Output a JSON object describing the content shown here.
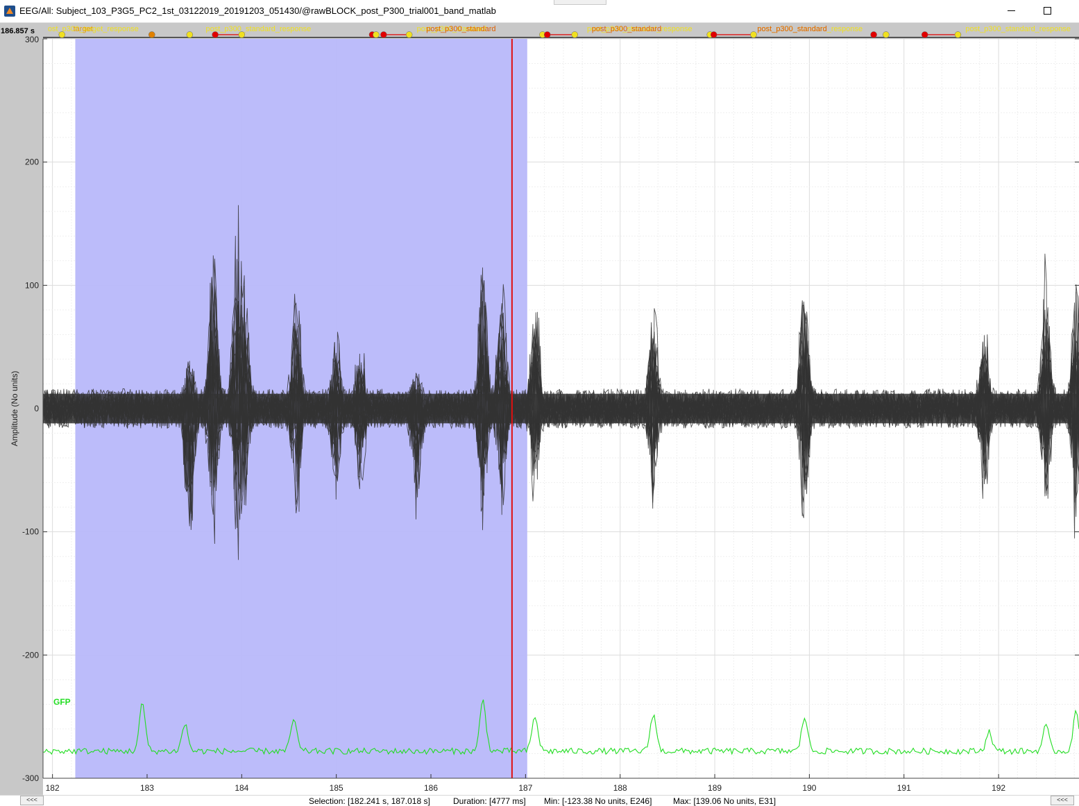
{
  "window": {
    "title": "EEG/All: Subject_103_P3G5_PC2_1st_03122019_20191203_051430/@rawBLOCK_post_P300_trial001_band_matlab",
    "icon": "matlab-icon",
    "minimize_icon": "minimize-icon",
    "maximize_icon": "maximize-icon"
  },
  "time_readout": "186.857 s",
  "chart_data": {
    "type": "line",
    "ylabel": "Amplitude (No units)",
    "xlim": [
      181.9,
      192.85
    ],
    "ylim": [
      -300,
      300
    ],
    "x_ticks": [
      182,
      183,
      184,
      185,
      186,
      187,
      188,
      189,
      190,
      191,
      192
    ],
    "y_ticks": [
      -300,
      -200,
      -100,
      0,
      100,
      200,
      300
    ],
    "grid": true,
    "selection": {
      "start": 182.241,
      "end": 187.018,
      "color": "#b8b8fa"
    },
    "cursor_time": 186.857,
    "cursor_color": "#e01010",
    "trace_color": "#333333",
    "gfp_color": "#22dd22",
    "series": [
      {
        "name": "GFP",
        "color": "#22dd22"
      }
    ],
    "bursts": [
      {
        "t": 183.95,
        "up": 135,
        "down": -100
      },
      {
        "t": 183.45,
        "up": 50,
        "down": -125
      },
      {
        "t": 183.7,
        "up": 130,
        "down": -110
      },
      {
        "t": 184.03,
        "up": 100,
        "down": -90
      },
      {
        "t": 184.58,
        "up": 105,
        "down": -95
      },
      {
        "t": 185.0,
        "up": 60,
        "down": -80
      },
      {
        "t": 185.25,
        "up": 55,
        "down": -70
      },
      {
        "t": 185.85,
        "up": 30,
        "down": -90
      },
      {
        "t": 186.55,
        "up": 122,
        "down": -105
      },
      {
        "t": 186.75,
        "up": 100,
        "down": -100
      },
      {
        "t": 187.1,
        "up": 100,
        "down": -75
      },
      {
        "t": 188.35,
        "up": 90,
        "down": -90
      },
      {
        "t": 189.95,
        "up": 125,
        "down": -97
      },
      {
        "t": 191.85,
        "up": 70,
        "down": -80
      },
      {
        "t": 192.5,
        "up": 115,
        "down": -80
      },
      {
        "t": 192.82,
        "up": 105,
        "down": -95
      }
    ],
    "gfp_peaks": [
      {
        "t": 182.95,
        "y": -240
      },
      {
        "t": 183.4,
        "y": -256
      },
      {
        "t": 184.55,
        "y": -252
      },
      {
        "t": 186.55,
        "y": -237
      },
      {
        "t": 187.1,
        "y": -250
      },
      {
        "t": 188.35,
        "y": -248
      },
      {
        "t": 189.95,
        "y": -250
      },
      {
        "t": 191.9,
        "y": -262
      },
      {
        "t": 192.5,
        "y": -258
      },
      {
        "t": 192.82,
        "y": -247
      }
    ],
    "events": {
      "labels": [
        {
          "t": 181.95,
          "text": "ost_p300_target_response",
          "color": "#f0e020"
        },
        {
          "t": 182.22,
          "text": "target",
          "color": "#e8a000"
        },
        {
          "t": 183.62,
          "text": "post_p300_standard_response",
          "color": "#f0e020"
        },
        {
          "t": 185.85,
          "text": "post_p300_standard",
          "color": "#f0e020"
        },
        {
          "t": 185.95,
          "text": "post_p300_standard",
          "color": "#e06000"
        },
        {
          "t": 187.65,
          "text": "post_p300_standard_response",
          "color": "#f0e020"
        },
        {
          "t": 187.7,
          "text": "post_p300_standard",
          "color": "#e06000"
        },
        {
          "t": 189.45,
          "text": "post_p300_standard_response",
          "color": "#f0e020"
        },
        {
          "t": 189.45,
          "text": "post_p300_standard",
          "color": "#e06000"
        },
        {
          "t": 191.65,
          "text": "post_p300_standard_response",
          "color": "#f0e020"
        }
      ],
      "markers": [
        {
          "t": 182.1,
          "color": "#f0e020"
        },
        {
          "t": 183.05,
          "color": "#e08000"
        },
        {
          "t": 183.45,
          "color": "#f0e020"
        },
        {
          "t": 183.72,
          "color": "#e00000"
        },
        {
          "t": 184.0,
          "color": "#f0e020"
        },
        {
          "t": 185.38,
          "color": "#e00000"
        },
        {
          "t": 185.42,
          "color": "#f0e020"
        },
        {
          "t": 185.5,
          "color": "#e00000"
        },
        {
          "t": 185.77,
          "color": "#f0e020"
        },
        {
          "t": 187.18,
          "color": "#f0e020"
        },
        {
          "t": 187.23,
          "color": "#e00000"
        },
        {
          "t": 187.52,
          "color": "#f0e020"
        },
        {
          "t": 188.95,
          "color": "#f0e020"
        },
        {
          "t": 188.99,
          "color": "#e00000"
        },
        {
          "t": 189.41,
          "color": "#f0e020"
        },
        {
          "t": 190.68,
          "color": "#e00000"
        },
        {
          "t": 190.81,
          "color": "#f0e020"
        },
        {
          "t": 191.22,
          "color": "#e00000"
        },
        {
          "t": 191.57,
          "color": "#f0e020"
        }
      ],
      "links": [
        {
          "from": 183.72,
          "to": 184.0
        },
        {
          "from": 185.5,
          "to": 185.77
        },
        {
          "from": 187.23,
          "to": 187.52
        },
        {
          "from": 188.99,
          "to": 189.41
        },
        {
          "from": 191.22,
          "to": 191.57
        }
      ]
    }
  },
  "status": {
    "selection": "Selection: [182.241 s, 187.018 s]",
    "duration": "Duration: [4777 ms]",
    "min": "Min: [-123.38 No units, E246]",
    "max": "Max: [139.06 No units, E31]"
  },
  "scroll_left_label": "<<<",
  "scroll_right_label": "<<<",
  "gfp_label": "GFP"
}
